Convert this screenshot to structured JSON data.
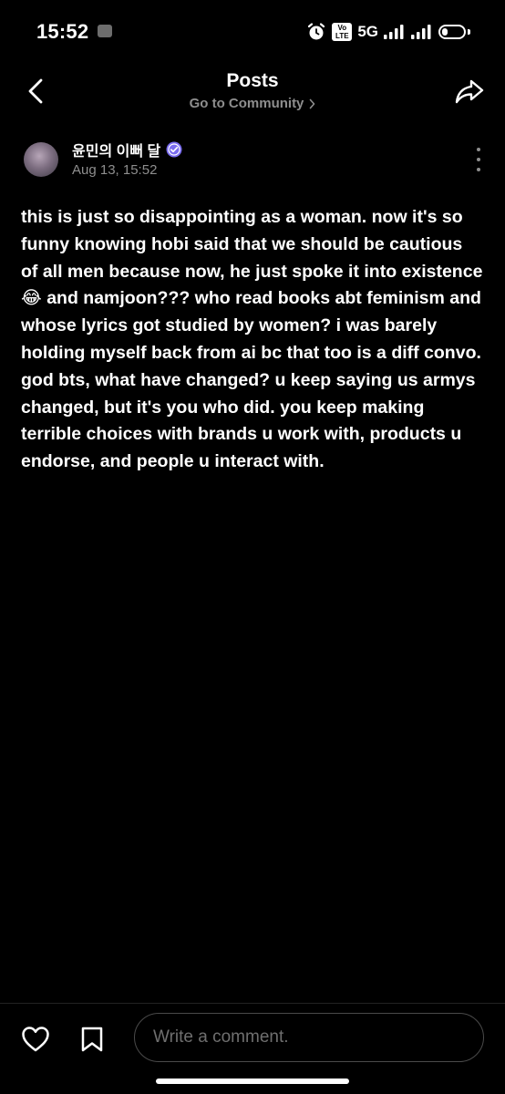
{
  "status_bar": {
    "time": "15:52",
    "network_badge": "Vo LTE",
    "network_type": "5G",
    "battery_level": 0.25,
    "icons": [
      "notification-icon",
      "alarm-icon",
      "signal-icon",
      "signal-icon",
      "battery-icon"
    ]
  },
  "header": {
    "title": "Posts",
    "community_link": "Go to Community",
    "icons": [
      "chevron-left-icon",
      "chevron-right-icon",
      "share-icon"
    ]
  },
  "post": {
    "author": "윤민의 이뻐 달",
    "date": "Aug 13, 15:52",
    "verified_icon": "verified-badge-icon",
    "body": "this is just so disappointing as a woman. now it's so funny knowing hobi said that we should be cautious of all men because now, he just spoke it into existence 😂 and namjoon??? who read books abt feminism and whose lyrics got studied by women? i was barely holding myself back from ai bc that too is a diff convo. god bts, what have changed? u keep saying us armys changed, but it's you who did. you keep making terrible choices with brands u work with, products u endorse, and people u interact with."
  },
  "bottom_bar": {
    "comment_placeholder": "Write a comment.",
    "icons": [
      "heart-icon",
      "bookmark-icon"
    ]
  },
  "colors": {
    "background": "#000000",
    "text": "#ffffff",
    "muted": "#8e8e8e",
    "verified": "#7a6cf0"
  }
}
